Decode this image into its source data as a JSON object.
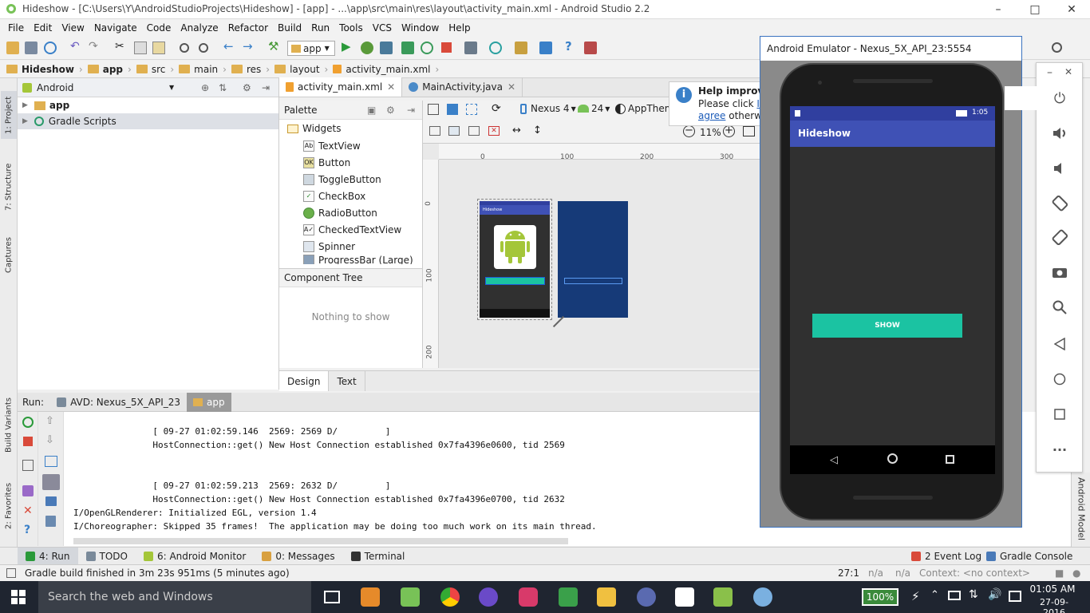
{
  "window": {
    "title": "Hideshow - [C:\\Users\\Y\\AndroidStudioProjects\\Hideshow] - [app] - ...\\app\\src\\main\\res\\layout\\activity_main.xml - Android Studio 2.2"
  },
  "menu": [
    "File",
    "Edit",
    "View",
    "Navigate",
    "Code",
    "Analyze",
    "Refactor",
    "Build",
    "Run",
    "Tools",
    "VCS",
    "Window",
    "Help"
  ],
  "toolbar": {
    "module": "app"
  },
  "breadcrumbs": [
    "Hideshow",
    "app",
    "src",
    "main",
    "res",
    "layout",
    "activity_main.xml"
  ],
  "left_tabs": [
    "1: Project",
    "7: Structure",
    "Captures",
    "Build Variants",
    "2: Favorites"
  ],
  "project": {
    "view_mode": "Android",
    "items": [
      "app",
      "Gradle Scripts"
    ]
  },
  "editor_tabs": [
    "activity_main.xml",
    "MainActivity.java"
  ],
  "palette": {
    "title": "Palette",
    "group": "Widgets",
    "items": [
      "TextView",
      "Button",
      "ToggleButton",
      "CheckBox",
      "RadioButton",
      "CheckedTextView",
      "Spinner",
      "ProgressBar (Large)"
    ]
  },
  "design_toolbar": {
    "device": "Nexus 4",
    "api": "24",
    "theme": "AppTheme",
    "zoom": "11%",
    "ruler": [
      "0",
      "100",
      "200",
      "300"
    ],
    "vruler": [
      "0",
      "100",
      "200"
    ],
    "preview_title": "Hideshow"
  },
  "component_tree": {
    "title": "Component Tree",
    "empty": "Nothing to show"
  },
  "design_tabs": [
    "Design",
    "Text"
  ],
  "help_box": {
    "title": "Help improve",
    "line1": "Please click",
    "link1": "I a",
    "link2": "agree",
    "line2": " otherwi"
  },
  "run": {
    "label": "Run:",
    "tabs": [
      "AVD: Nexus_5X_API_23",
      "app"
    ]
  },
  "console_lines": [
    "               [ 09-27 01:02:59.146  2569: 2569 D/         ]",
    "               HostConnection::get() New Host Connection established 0x7fa4396e0600, tid 2569",
    "",
    "",
    "               [ 09-27 01:02:59.213  2569: 2632 D/         ]",
    "               HostConnection::get() New Host Connection established 0x7fa4396e0700, tid 2632",
    "I/OpenGLRenderer: Initialized EGL, version 1.4",
    "I/Choreographer: Skipped 35 frames!  The application may be doing too much work on its main thread."
  ],
  "tool_tabs": [
    "4: Run",
    "TODO",
    "6: Android Monitor",
    "0: Messages",
    "Terminal"
  ],
  "tool_tabs_right": [
    "2 Event Log",
    "Gradle Console"
  ],
  "right_tab": "Android Model",
  "status": {
    "message": "Gradle build finished in 3m 23s 951ms (5 minutes ago)",
    "position": "27:1",
    "na1": "n/a",
    "na2": "n/a",
    "context": "Context: <no context>"
  },
  "emulator": {
    "title": "Android Emulator - Nexus_5X_API_23:5554",
    "time": "1:05",
    "app_title": "Hideshow",
    "button": "SHOW"
  },
  "taskbar": {
    "search": "Search the web and Windows",
    "battery": "100%",
    "time": "01:05 AM",
    "date": "27-09-2016"
  },
  "colors": {
    "accent": "#3f51b5",
    "status_bar": "#303f9f",
    "button": "#1bc3a2",
    "blueprint": "#163a78"
  }
}
